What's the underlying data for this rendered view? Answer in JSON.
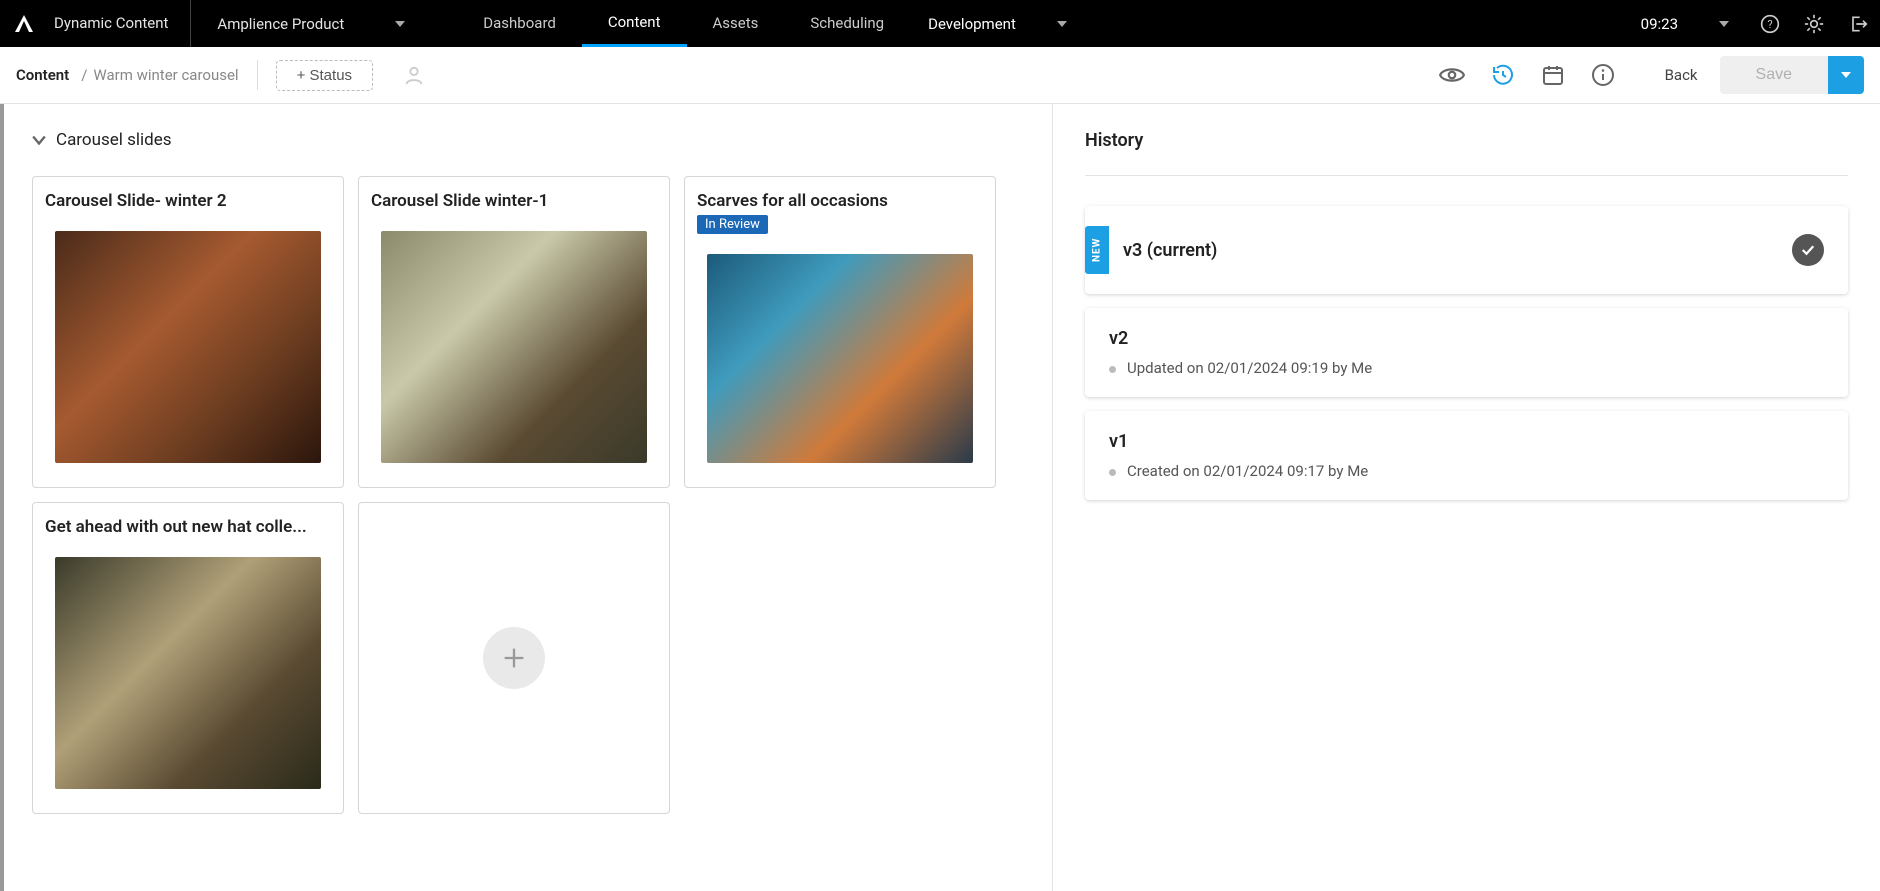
{
  "topbar": {
    "app_name": "Dynamic Content",
    "product_label": "Amplience Product",
    "nav": {
      "dashboard": "Dashboard",
      "content": "Content",
      "assets": "Assets",
      "scheduling": "Scheduling"
    },
    "environment": "Development",
    "time": "09:23"
  },
  "contextbar": {
    "crumb_root": "Content",
    "crumb_sep": "/",
    "crumb_current": "Warm winter carousel",
    "add_status": "+ Status",
    "back": "Back",
    "save": "Save"
  },
  "slides": {
    "section_title": "Carousel slides",
    "items": [
      {
        "title": "Carousel Slide- winter 2",
        "badge": "",
        "thumb_class": "t1"
      },
      {
        "title": "Carousel Slide winter-1",
        "badge": "",
        "thumb_class": "t2"
      },
      {
        "title": "Scarves for all occasions",
        "badge": "In Review",
        "thumb_class": "t3"
      },
      {
        "title": "Get ahead with out new hat colle...",
        "badge": "",
        "thumb_class": "t4"
      }
    ]
  },
  "history": {
    "title": "History",
    "new_ribbon": "NEW",
    "items": [
      {
        "version": "v3 (current)",
        "meta": ""
      },
      {
        "version": "v2",
        "meta": "Updated on 02/01/2024 09:19 by Me"
      },
      {
        "version": "v1",
        "meta": "Created on 02/01/2024 09:17 by Me"
      }
    ]
  }
}
